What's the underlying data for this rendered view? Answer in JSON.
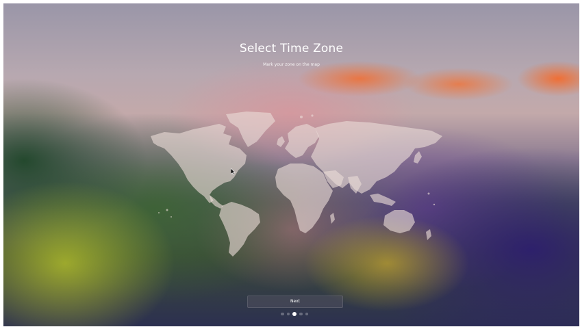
{
  "setup": {
    "title": "Select Time Zone",
    "subtitle": "Mark your zone on the map",
    "next_label": "Next",
    "step_count": 5,
    "current_step": 3
  },
  "colors": {
    "text": "#ffffff",
    "map_fill": "#e9dcd6",
    "button_bg": "#50505f"
  },
  "icons": {
    "cursor": "arrow-cursor-icon"
  }
}
